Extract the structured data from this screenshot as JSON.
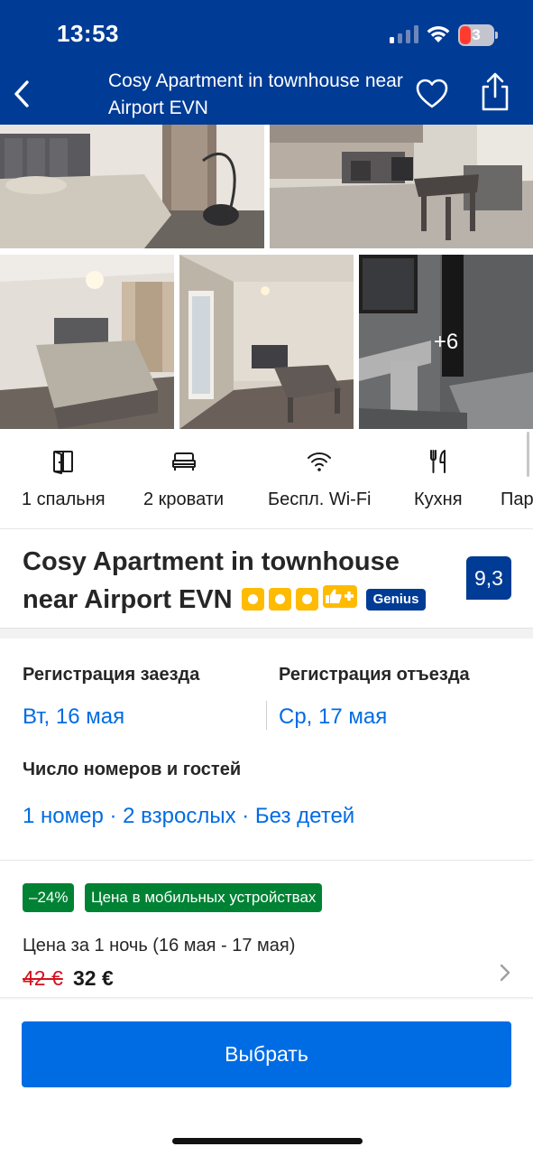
{
  "status_bar": {
    "time": "13:53",
    "battery_level": "3"
  },
  "nav": {
    "title": "Cosy Apartment in townhouse near Airport EVN",
    "back_icon": "chevron-left-icon",
    "favorite_icon": "heart-icon",
    "share_icon": "share-icon"
  },
  "gallery": {
    "more_photos": "+6"
  },
  "facilities": [
    {
      "icon": "door-icon",
      "label": "1 спальня"
    },
    {
      "icon": "bed-icon",
      "label": "2 кровати"
    },
    {
      "icon": "wifi-icon",
      "label": "Беспл. Wi-Fi"
    },
    {
      "icon": "fork-knife-icon",
      "label": "Кухня"
    },
    {
      "icon": "parking-icon",
      "label": "Пар"
    }
  ],
  "property": {
    "title": "Cosy Apartment in townhouse near Airport EVN",
    "stars": 3,
    "genius_label": "Genius",
    "score": "9,3"
  },
  "dates": {
    "checkin_label": "Регистрация заезда",
    "checkin_value": "Вт, 16 мая",
    "checkout_label": "Регистрация отъезда",
    "checkout_value": "Ср, 17 мая",
    "guests_label": "Число номеров и гостей",
    "guests_value": "1 номер · 2 взрослых · Без детей"
  },
  "price": {
    "discount_badge": "–24%",
    "mobile_badge": "Цена в мобильных устройствах",
    "label": "Цена за 1 ночь (16 мая - 17 мая)",
    "old": "42 €",
    "new": "32 €"
  },
  "cta": {
    "label": "Выбрать"
  },
  "colors": {
    "brand_blue": "#003b95",
    "action_blue": "#006ce4",
    "star_yellow": "#febb02",
    "deal_green": "#008234",
    "strike_red": "#d4111e"
  }
}
